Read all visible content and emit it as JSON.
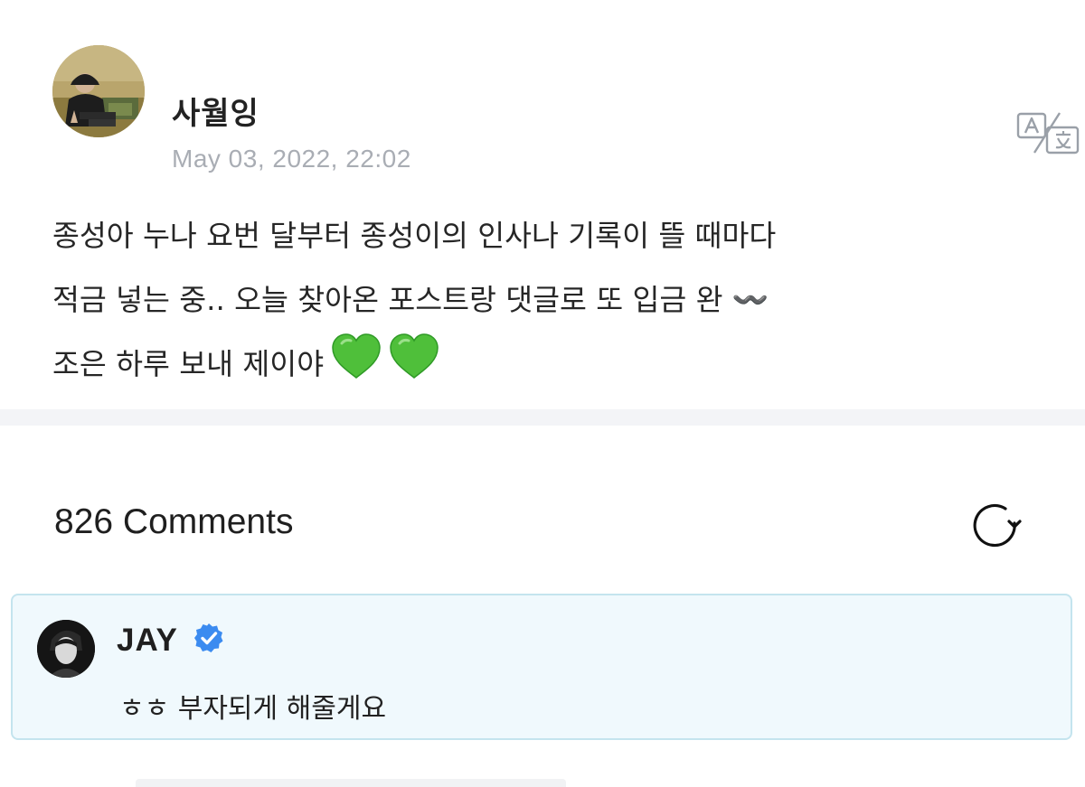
{
  "post": {
    "author": "사월잉",
    "avatar_icon": "user-photo-avatar",
    "timestamp": "May 03, 2022, 22:02",
    "translate_icon": "translate-icon",
    "body_lines": [
      "종성아 누나 요번 달부터 종성이의 인사나 기록이 뜰 때마다",
      "적금 넣는 중.. 오늘 찾아온 포스트랑 댓글로 또 입금 완 〰️",
      "조은 하루 보내 제이야"
    ],
    "emoji_hearts": [
      "green-heart",
      "green-heart"
    ]
  },
  "comments": {
    "count_label": "826 Comments",
    "refresh_icon": "refresh-icon",
    "highlighted": {
      "author": "JAY",
      "verified_icon": "verified-badge-icon",
      "text": "ㅎㅎ 부자되게 해줄게요",
      "accent_bg": "#f0f9fd",
      "accent_border": "#c4e4ee",
      "badge_color": "#3b8bf0"
    }
  }
}
